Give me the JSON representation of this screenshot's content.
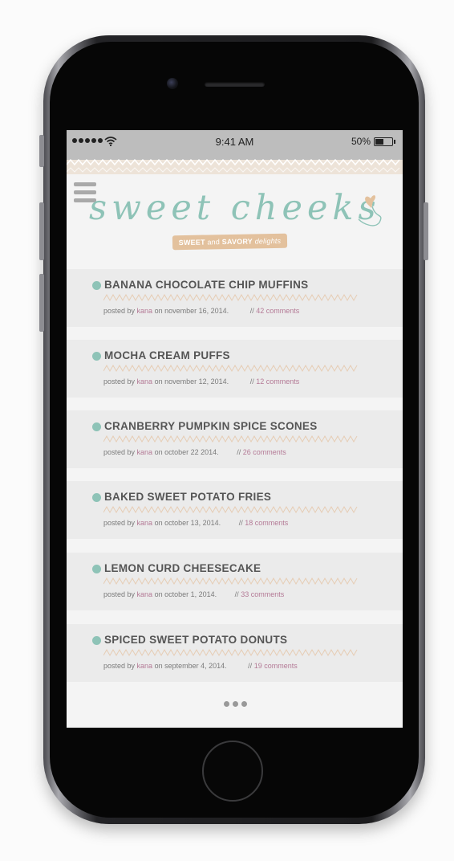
{
  "status_bar": {
    "time": "9:41 AM",
    "battery_percent": "50%",
    "battery_level": 0.5,
    "signal_bars": 5
  },
  "header": {
    "logo_text": "sweet cheeks",
    "tagline": {
      "sweet": "SWEET",
      "and": "and",
      "savory": "SAVORY",
      "delights": "delights"
    }
  },
  "posts": [
    {
      "title": "BANANA CHOCOLATE CHIP MUFFINS",
      "posted_by": "posted by",
      "author": "kana",
      "date": "on november 16, 2014.",
      "sep": "//",
      "comments": "42 comments"
    },
    {
      "title": "MOCHA CREAM PUFFS",
      "posted_by": "posted by",
      "author": "kana",
      "date": "on november 12, 2014.",
      "sep": "//",
      "comments": "12 comments"
    },
    {
      "title": "CRANBERRY PUMPKIN SPICE SCONES",
      "posted_by": "posted by",
      "author": "kana",
      "date": "on october 22 2014.",
      "sep": "//",
      "comments": "26 comments"
    },
    {
      "title": "BAKED SWEET POTATO FRIES",
      "posted_by": "posted by",
      "author": "kana",
      "date": "on october 13, 2014.",
      "sep": "//",
      "comments": "18 comments"
    },
    {
      "title": "LEMON CURD CHEESECAKE",
      "posted_by": "posted by",
      "author": "kana",
      "date": "on october 1, 2014.",
      "sep": "//",
      "comments": "33 comments"
    },
    {
      "title": "SPICED SWEET POTATO DONUTS",
      "posted_by": "posted by",
      "author": "kana",
      "date": "on september 4, 2014.",
      "sep": "//",
      "comments": "19 comments"
    }
  ],
  "colors": {
    "accent_teal": "#8ec3b7",
    "accent_pink": "#b47a96",
    "accent_tan": "#e3c19d"
  }
}
